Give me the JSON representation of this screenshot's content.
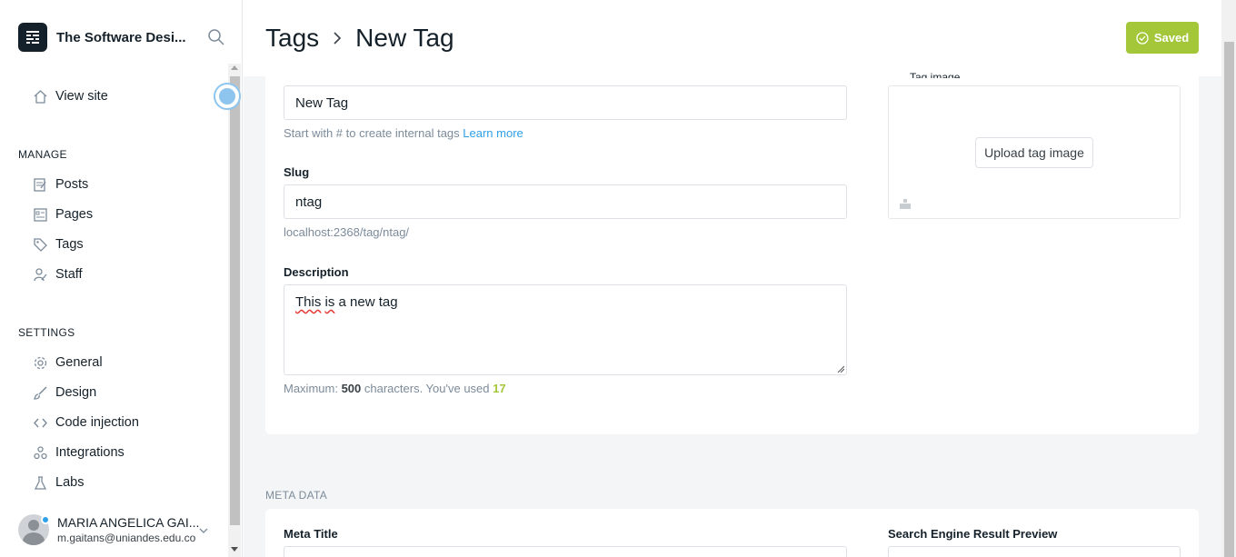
{
  "brand": {
    "name": "The Software Desi..."
  },
  "nav": {
    "view_site": "View site",
    "manage_label": "MANAGE",
    "posts": "Posts",
    "pages": "Pages",
    "tags": "Tags",
    "staff": "Staff",
    "settings_label": "SETTINGS",
    "general": "General",
    "design": "Design",
    "code_injection": "Code injection",
    "integrations": "Integrations",
    "labs": "Labs"
  },
  "user": {
    "name": "MARIA ANGELICA GAI...",
    "email": "m.gaitans@uniandes.edu.co"
  },
  "header": {
    "crumb_parent": "Tags",
    "crumb_current": "New Tag",
    "saved_label": "Saved",
    "accent": "#a4c639"
  },
  "form": {
    "name_value": "New Tag",
    "name_help": "Start with # to create internal tags",
    "learn_more": "Learn more",
    "slug_label": "Slug",
    "slug_value": "ntag",
    "slug_url": "localhost:2368/tag/ntag/",
    "description_label": "Description",
    "description_word1": "This",
    "description_word2": "is",
    "description_rest": " a new tag",
    "max_prefix": "Maximum: ",
    "max_value": "500",
    "max_suffix": " characters. You've used ",
    "used_value": "17",
    "image_label_clipped": "Tag image",
    "upload_button": "Upload tag image"
  },
  "meta": {
    "section_label": "META DATA",
    "meta_title_label": "Meta Title",
    "preview_label": "Search Engine Result Preview"
  }
}
